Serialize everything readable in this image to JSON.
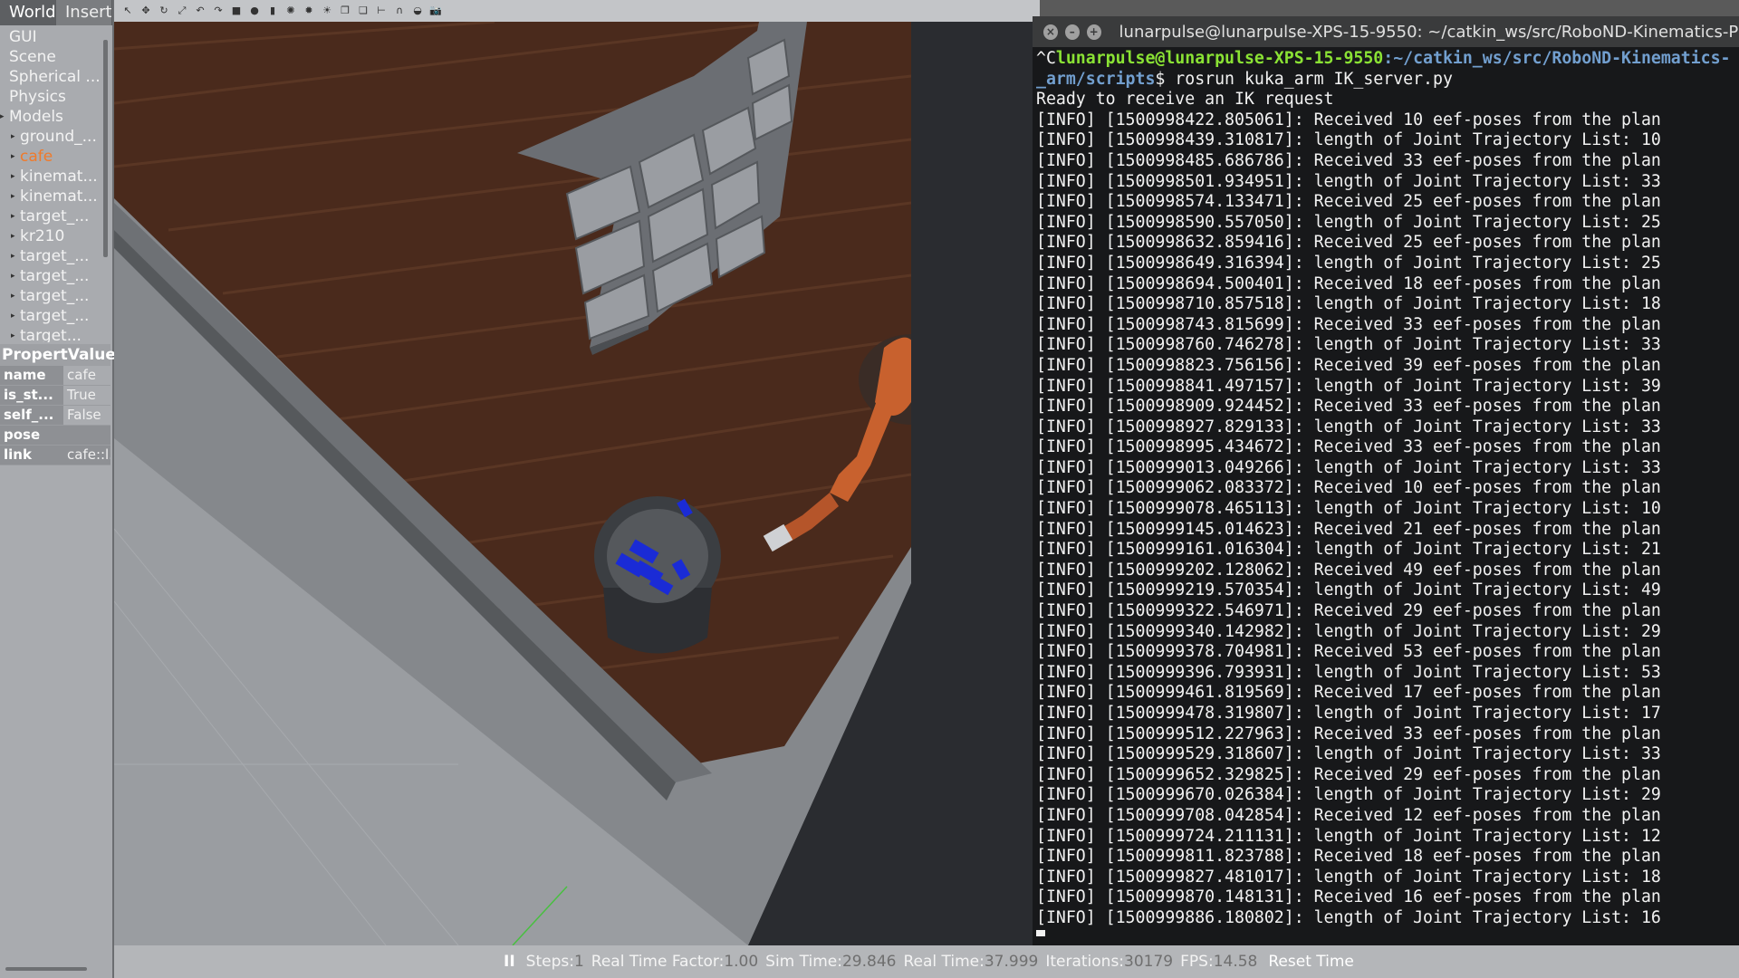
{
  "left_panel": {
    "tabs": [
      "World",
      "Insert"
    ],
    "tree": [
      {
        "label": "GUI",
        "arrow": false,
        "selected": false
      },
      {
        "label": "Scene",
        "arrow": false,
        "selected": false
      },
      {
        "label": "Spherical ...",
        "arrow": false,
        "selected": false
      },
      {
        "label": "Physics",
        "arrow": false,
        "selected": false
      },
      {
        "label": "Models",
        "arrow": true,
        "selected": false
      },
      {
        "label": "ground_...",
        "arrow": true,
        "selected": false
      },
      {
        "label": "cafe",
        "arrow": true,
        "selected": true
      },
      {
        "label": "kinemat...",
        "arrow": true,
        "selected": false
      },
      {
        "label": "kinemat...",
        "arrow": true,
        "selected": false
      },
      {
        "label": "target_...",
        "arrow": true,
        "selected": false
      },
      {
        "label": "kr210",
        "arrow": true,
        "selected": false
      },
      {
        "label": "target_...",
        "arrow": true,
        "selected": false
      },
      {
        "label": "target_...",
        "arrow": true,
        "selected": false
      },
      {
        "label": "target_...",
        "arrow": true,
        "selected": false
      },
      {
        "label": "target_...",
        "arrow": true,
        "selected": false
      },
      {
        "label": "target...",
        "arrow": true,
        "selected": false
      }
    ],
    "properties": {
      "header_property": "Propert",
      "header_value": "Value",
      "rows": [
        {
          "key": "name",
          "value": "cafe"
        },
        {
          "key": "is_st...",
          "value": "True"
        },
        {
          "key": "self_...",
          "value": "False"
        },
        {
          "key": "pose",
          "value": ""
        },
        {
          "key": "link",
          "value": "cafe::l..."
        }
      ]
    }
  },
  "status_bar": {
    "pause": "II",
    "steps_label": "Steps:",
    "steps_value": "1",
    "rtf_label": "Real Time Factor:",
    "rtf_value": "1.00",
    "sim_time_label": "Sim Time:",
    "sim_time_value": "29.846",
    "real_time_label": "Real Time:",
    "real_time_value": "37.999",
    "iterations_label": "Iterations:",
    "iterations_value": "30179",
    "fps_label": "FPS:",
    "fps_value": "14.58",
    "reset_label": "Reset Time"
  },
  "terminal": {
    "title": "lunarpulse@lunarpulse-XPS-15-9550: ~/catkin_ws/src/RoboND-Kinematics-Project",
    "prompt_prefix": "^C",
    "prompt_user": "lunarpulse@lunarpulse-XPS-15-9550",
    "prompt_path": ":~/catkin_ws/src/RoboND-Kinematics-Project/kuka_arm/scripts",
    "prompt_path_line1": ":~/catkin_ws/src/RoboND-Kinematics-",
    "prompt_path_line2": "_arm/scripts",
    "command": "$ rosrun kuka_arm IK_server.py",
    "ready": "Ready to receive an IK request",
    "log": [
      "[INFO] [1500998422.805061]: Received 10 eef-poses from the plan",
      "[INFO] [1500998439.310817]: length of Joint Trajectory List: 10",
      "[INFO] [1500998485.686786]: Received 33 eef-poses from the plan",
      "[INFO] [1500998501.934951]: length of Joint Trajectory List: 33",
      "[INFO] [1500998574.133471]: Received 25 eef-poses from the plan",
      "[INFO] [1500998590.557050]: length of Joint Trajectory List: 25",
      "[INFO] [1500998632.859416]: Received 25 eef-poses from the plan",
      "[INFO] [1500998649.316394]: length of Joint Trajectory List: 25",
      "[INFO] [1500998694.500401]: Received 18 eef-poses from the plan",
      "[INFO] [1500998710.857518]: length of Joint Trajectory List: 18",
      "[INFO] [1500998743.815699]: Received 33 eef-poses from the plan",
      "[INFO] [1500998760.746278]: length of Joint Trajectory List: 33",
      "[INFO] [1500998823.756156]: Received 39 eef-poses from the plan",
      "[INFO] [1500998841.497157]: length of Joint Trajectory List: 39",
      "[INFO] [1500998909.924452]: Received 33 eef-poses from the plan",
      "[INFO] [1500998927.829133]: length of Joint Trajectory List: 33",
      "[INFO] [1500998995.434672]: Received 33 eef-poses from the plan",
      "[INFO] [1500999013.049266]: length of Joint Trajectory List: 33",
      "[INFO] [1500999062.083372]: Received 10 eef-poses from the plan",
      "[INFO] [1500999078.465113]: length of Joint Trajectory List: 10",
      "[INFO] [1500999145.014623]: Received 21 eef-poses from the plan",
      "[INFO] [1500999161.016304]: length of Joint Trajectory List: 21",
      "[INFO] [1500999202.128062]: Received 49 eef-poses from the plan",
      "[INFO] [1500999219.570354]: length of Joint Trajectory List: 49",
      "[INFO] [1500999322.546971]: Received 29 eef-poses from the plan",
      "[INFO] [1500999340.142982]: length of Joint Trajectory List: 29",
      "[INFO] [1500999378.704981]: Received 53 eef-poses from the plan",
      "[INFO] [1500999396.793931]: length of Joint Trajectory List: 53",
      "[INFO] [1500999461.819569]: Received 17 eef-poses from the plan",
      "[INFO] [1500999478.319807]: length of Joint Trajectory List: 17",
      "[INFO] [1500999512.227963]: Received 33 eef-poses from the plan",
      "[INFO] [1500999529.318607]: length of Joint Trajectory List: 33",
      "[INFO] [1500999652.329825]: Received 29 eef-poses from the plan",
      "[INFO] [1500999670.026384]: length of Joint Trajectory List: 29",
      "[INFO] [1500999708.042854]: Received 12 eef-poses from the plan",
      "[INFO] [1500999724.211131]: length of Joint Trajectory List: 12",
      "[INFO] [1500999811.823788]: Received 18 eef-poses from the plan",
      "[INFO] [1500999827.481017]: length of Joint Trajectory List: 18",
      "[INFO] [1500999870.148131]: Received 16 eef-poses from the plan",
      "[INFO] [1500999886.180802]: length of Joint Trajectory List: 16"
    ]
  },
  "toolbar": {
    "icons": [
      "arrow-select-icon",
      "translate-icon",
      "rotate-icon",
      "scale-icon",
      "undo-icon",
      "redo-icon",
      "box-icon",
      "sphere-icon",
      "cylinder-icon",
      "point-light-icon",
      "spot-light-icon",
      "directional-light-icon",
      "copy-icon",
      "paste-icon",
      "align-icon",
      "snap-icon",
      "change-view-icon",
      "screenshot-icon"
    ]
  },
  "colors": {
    "selected_tree": "#f07a2a",
    "prompt_user": "#8ae234",
    "prompt_path": "#729fcf",
    "floor": "#4a2a1c",
    "robot": "#c8612e"
  }
}
